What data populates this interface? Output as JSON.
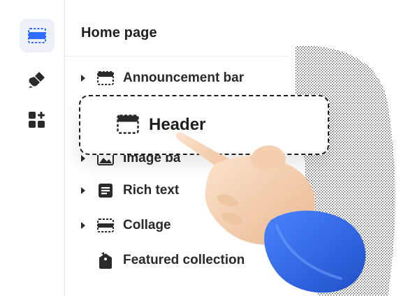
{
  "panel": {
    "title": "Home page"
  },
  "rail": {
    "items": [
      {
        "icon": "sections-icon",
        "active": true
      },
      {
        "icon": "paint-brush-icon",
        "active": false
      },
      {
        "icon": "apps-add-icon",
        "active": false
      }
    ]
  },
  "sections": [
    {
      "label": "Announcement bar",
      "icon": "header-section-icon",
      "expandable": true
    },
    {
      "label": "Image ba",
      "icon": "image-icon",
      "expandable": true
    },
    {
      "label": "Rich text",
      "icon": "text-block-icon",
      "expandable": true
    },
    {
      "label": "Collage",
      "icon": "collage-icon",
      "expandable": true
    },
    {
      "label": "Featured collection",
      "icon": "tag-icon",
      "expandable": false
    }
  ],
  "dragged_item": {
    "label": "Header",
    "icon": "header-section-icon"
  },
  "colors": {
    "text": "#1f1f1f",
    "rail_active_bg": "#eef0f7",
    "accent_blue": "#2f6bff",
    "sleeve_blue": "#2a5bd7",
    "skin": "#f6d3b3"
  }
}
